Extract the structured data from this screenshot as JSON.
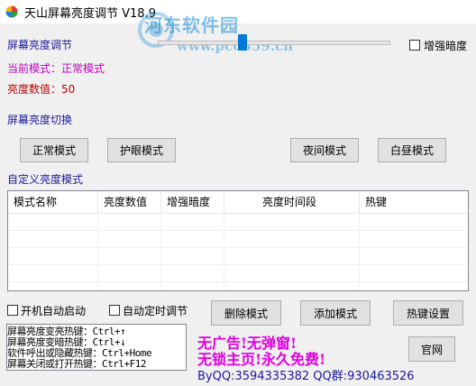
{
  "window": {
    "title": "天山屏幕亮度调节 V18.9"
  },
  "watermark": {
    "site_name": "河东软件园",
    "url": "www.pc0359.cn"
  },
  "brightness": {
    "section_label": "屏幕亮度调节",
    "slider_level": 0.36,
    "enhance_dark_label": "增强暗度",
    "current_mode_label": "当前模式：正常模式",
    "value_label": "亮度数值：50"
  },
  "mode_switch": {
    "section_label": "屏幕亮度切换",
    "buttons": [
      "正常模式",
      "护眼模式",
      "夜间模式",
      "白昼模式"
    ]
  },
  "custom": {
    "section_label": "自定义亮度模式",
    "columns": [
      "模式名称",
      "亮度数值",
      "增强暗度",
      "亮度时间段",
      "热键"
    ]
  },
  "options": {
    "autostart_label": "开机自动启动",
    "auto_timer_label": "自动定时调节"
  },
  "actions": {
    "delete_label": "删除模式",
    "add_label": "添加模式",
    "hotkey_settings_label": "热键设置",
    "website_label": "官网"
  },
  "hotkeys": [
    "屏幕亮度变亮热键：Ctrl+↑",
    "屏幕亮度变暗热键：Ctrl+↓",
    "软件呼出或隐藏热键：Ctrl+Home",
    "屏幕关闭或打开热键：Ctrl+F12"
  ],
  "promo": {
    "line1": "无广告!无弹窗!",
    "line2": "无锁主页!永久免费!",
    "contact": "ByQQ:3594335382 QQ群:930463526"
  },
  "colors": {
    "accent": "#0078d7",
    "promo": "#e000e0",
    "label_blue": "#1a1a9c",
    "mode_purple": "#c000c0",
    "value_red": "#c00000"
  }
}
